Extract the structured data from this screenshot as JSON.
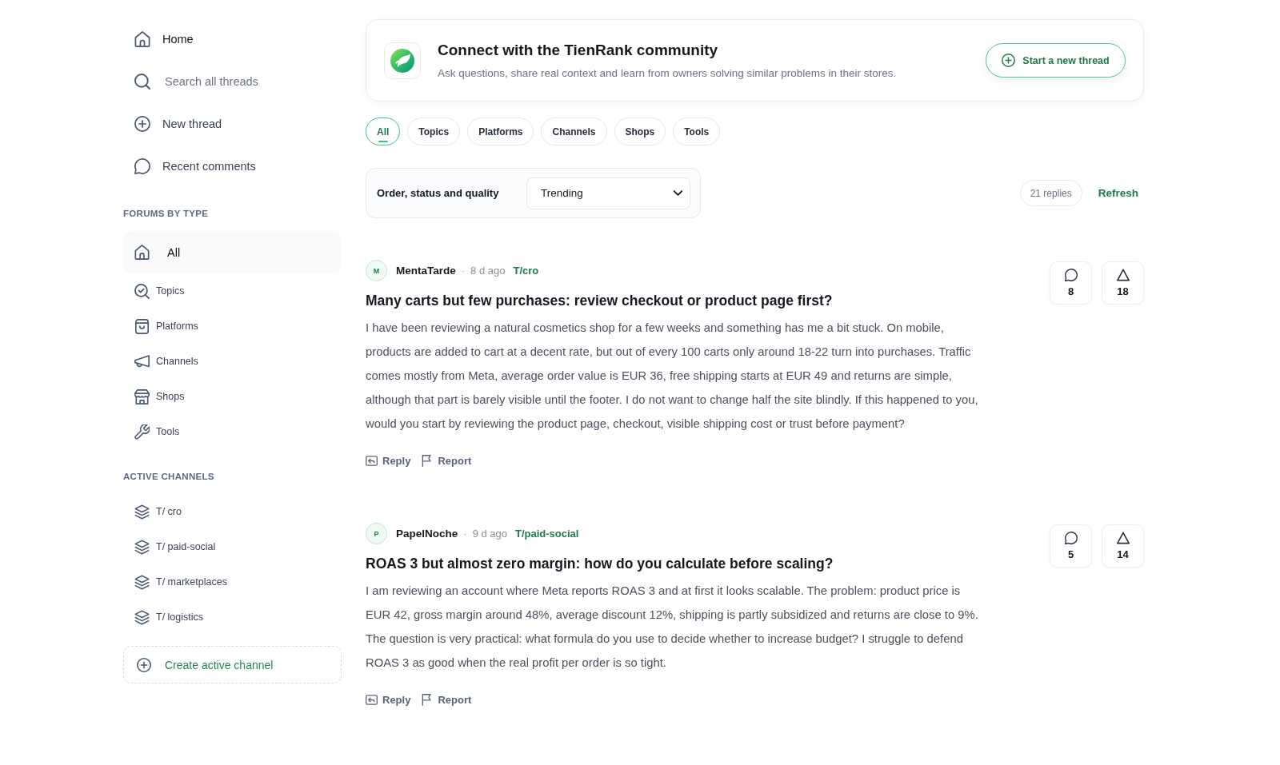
{
  "sidebar": {
    "nav": [
      {
        "kind": "link",
        "label": "Home",
        "selected": true
      },
      {
        "kind": "search",
        "placeholder": "Search all threads"
      },
      {
        "kind": "link",
        "label": "New thread",
        "selected": false
      },
      {
        "kind": "link",
        "label": "Recent comments",
        "selected": false
      }
    ],
    "forums": {
      "heading": "FORUMS BY TYPE",
      "items": [
        {
          "label": "All",
          "selected": true
        },
        {
          "label": "Topics",
          "selected": false
        },
        {
          "label": "Platforms",
          "selected": false
        },
        {
          "label": "Channels",
          "selected": false
        },
        {
          "label": "Shops",
          "selected": false
        },
        {
          "label": "Tools",
          "selected": false
        }
      ]
    },
    "channels": {
      "heading": "ACTIVE CHANNELS",
      "items": [
        {
          "label": "T/ cro"
        },
        {
          "label": "T/ paid-social"
        },
        {
          "label": "T/ marketplaces"
        },
        {
          "label": "T/ logistics"
        }
      ],
      "create_button": "Create active channel"
    }
  },
  "intro": {
    "title": "Connect with the TienRank community",
    "subtitle": "Ask questions, share real context and learn from owners solving similar problems in their stores.",
    "button": "Start a new thread"
  },
  "filters": [
    {
      "label": "All",
      "selected": true
    },
    {
      "label": "Topics",
      "selected": false
    },
    {
      "label": "Platforms",
      "selected": false
    },
    {
      "label": "Channels",
      "selected": false
    },
    {
      "label": "Shops",
      "selected": false
    },
    {
      "label": "Tools",
      "selected": false
    }
  ],
  "sort": {
    "label": "Order, status and quality",
    "value": "Trending"
  },
  "replies_count": "21 replies",
  "refresh": "Refresh",
  "posts": [
    {
      "initial": "M",
      "author": "MentaTarde",
      "separator": "·",
      "age": "8 d ago",
      "channel": "T/cro",
      "title": "Many carts but few purchases: review checkout or product page first?",
      "body": "I have been reviewing a natural cosmetics shop for a few weeks and something has me a bit stuck. On mobile, products are added to cart at a decent rate, but out of every 100 carts only around 18-22 turn into purchases. Traffic comes mostly from Meta, average order value is EUR 36, free shipping starts at EUR 49 and returns are simple, although that part is barely visible until the footer. I do not want to change half the site blindly. If this happened to you, would you start by reviewing the product page, checkout, visible shipping cost or trust before payment?",
      "comments": "8",
      "votes": "18",
      "actions": [
        "Reply",
        "Report"
      ]
    },
    {
      "initial": "P",
      "author": "PapelNoche",
      "separator": "·",
      "age": "9 d ago",
      "channel": "T/paid-social",
      "title": "ROAS 3 but almost zero margin: how do you calculate before scaling?",
      "body": "I am reviewing an account where Meta reports ROAS 3 and at first it looks scalable. The problem: product price is EUR 42, gross margin around 48%, average discount 12%, shipping is partly subsidized and returns are close to 9%. The question is very practical: what formula do you use to decide whether to increase budget? I struggle to defend ROAS 3 as good when the real profit per order is so tight.",
      "comments": "5",
      "votes": "14",
      "actions": [
        "Reply",
        "Report"
      ]
    }
  ]
}
